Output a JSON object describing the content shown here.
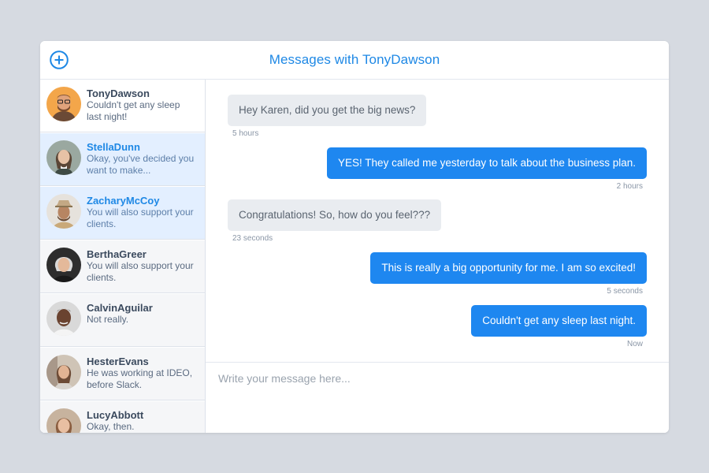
{
  "header": {
    "title": "Messages with TonyDawson",
    "new_icon": "plus-circle-icon",
    "accent": "#1e88e5"
  },
  "contacts": [
    {
      "name": "TonyDawson",
      "preview": "Couldn't get any sleep last night!",
      "state": "active"
    },
    {
      "name": "StellaDunn",
      "preview": "Okay, you've decided you want to make...",
      "state": "highlight"
    },
    {
      "name": "ZacharyMcCoy",
      "preview": "You will also support your clients.",
      "state": "highlight"
    },
    {
      "name": "BerthaGreer",
      "preview": "You will also support your clients.",
      "state": "normal"
    },
    {
      "name": "CalvinAguilar",
      "preview": "Not really.",
      "state": "normal"
    },
    {
      "name": "HesterEvans",
      "preview": "He was working at IDEO, before Slack.",
      "state": "normal"
    },
    {
      "name": "LucyAbbott",
      "preview": "Okay, then.",
      "state": "normal"
    }
  ],
  "messages": [
    {
      "text": "Hey Karen, did you get the big news?",
      "time": "5 hours",
      "direction": "in"
    },
    {
      "text": "YES! They called me yesterday to talk about the business plan.",
      "time": "2 hours",
      "direction": "out"
    },
    {
      "text": "Congratulations! So, how do you feel???",
      "time": "23 seconds",
      "direction": "in"
    },
    {
      "text": "This is really a big opportunity for me. I am so excited!",
      "time": "5 seconds",
      "direction": "out"
    },
    {
      "text": "Couldn't get any sleep last night.",
      "time": "Now",
      "direction": "out"
    }
  ],
  "composer": {
    "placeholder": "Write your message here..."
  },
  "colors": {
    "incoming_bubble": "#e9ecf0",
    "outgoing_bubble": "#1e87f0",
    "highlight_row": "#e3efff"
  }
}
